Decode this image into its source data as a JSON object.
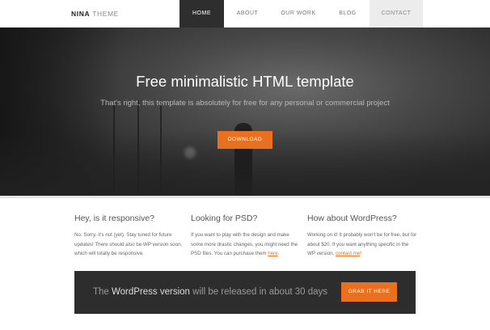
{
  "header": {
    "logo_bold": "NINA",
    "logo_light": "THEME",
    "nav": [
      {
        "label": "HOME"
      },
      {
        "label": "ABOUT"
      },
      {
        "label": "OUR WORK"
      },
      {
        "label": "BLOG"
      },
      {
        "label": "CONTACT"
      }
    ]
  },
  "hero": {
    "title": "Free minimalistic HTML template",
    "subtitle": "That's right, this template is absolutely for free for any personal or commercial project",
    "button_label": "DOWNLOAD"
  },
  "columns": [
    {
      "title": "Hey, is it responsive?",
      "text": "No. Sorry, it's not (yet). Stay tuned for future updates! There should also be WP version soon, which will totally be responsive."
    },
    {
      "title": "Looking for PSD?",
      "text": "If you want to play with the design and make some more drastic changes, you might need the PSD files. You can purchase them",
      "link": "here",
      "tail": "."
    },
    {
      "title": "How about WordPress?",
      "text": "Working on it! It probably won't be for free, but for about $20. If you want anything specific in the WP version,",
      "link": "contact me",
      "tail": "!"
    }
  ],
  "banner": {
    "prefix": "The ",
    "highlight": "WordPress version",
    "suffix": " will be released in about 30 days",
    "button_label": "GRAB IT HERE"
  },
  "colors": {
    "accent": "#e8701e",
    "nav_active_bg": "#2e2e2e",
    "banner_bg": "#2d2d2d"
  }
}
